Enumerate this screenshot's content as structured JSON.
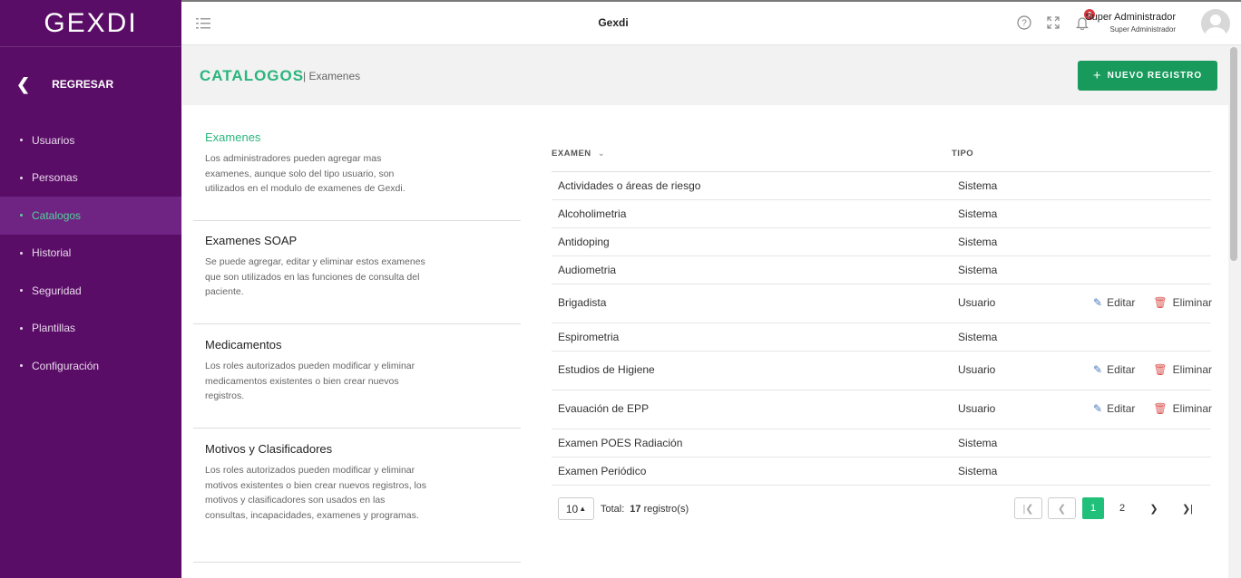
{
  "sidebar": {
    "logo": "GEXDI",
    "back_label": "REGRESAR",
    "items": [
      {
        "label": "Usuarios"
      },
      {
        "label": "Personas"
      },
      {
        "label": "Catalogos"
      },
      {
        "label": "Historial"
      },
      {
        "label": "Seguridad"
      },
      {
        "label": "Plantillas"
      },
      {
        "label": "Configuración"
      }
    ]
  },
  "header": {
    "title": "Gexdi",
    "notifications_count": "2",
    "user_name": "Super Administrador",
    "user_role": "Super Administrador"
  },
  "page": {
    "title": "CATALOGOS",
    "subtitle": "| Examenes",
    "new_button": "NUEVO REGISTRO"
  },
  "catalogs": [
    {
      "title": "Examenes",
      "desc": "Los administradores pueden agregar mas examenes, aunque solo del tipo usuario, son utilizados en el modulo de examenes de Gexdi."
    },
    {
      "title": "Examenes SOAP",
      "desc": "Se puede agregar, editar y eliminar estos examenes que son utilizados en las funciones de consulta del paciente."
    },
    {
      "title": "Medicamentos",
      "desc": "Los roles autorizados pueden modificar y eliminar medicamentos existentes o bien crear nuevos registros."
    },
    {
      "title": "Motivos y Clasificadores",
      "desc": "Los roles autorizados pueden modificar y eliminar motivos existentes o bien crear nuevos registros, los motivos y clasificadores son usados en las consultas, incapacidades, examenes y programas."
    }
  ],
  "table": {
    "col_examen": "EXAMEN",
    "col_tipo": "TIPO",
    "edit_label": "Editar",
    "delete_label": "Eliminar",
    "rows": [
      {
        "examen": "Actividades o áreas de riesgo",
        "tipo": "Sistema"
      },
      {
        "examen": "Alcoholimetria",
        "tipo": "Sistema"
      },
      {
        "examen": "Antidoping",
        "tipo": "Sistema"
      },
      {
        "examen": "Audiometria",
        "tipo": "Sistema"
      },
      {
        "examen": "Brigadista",
        "tipo": "Usuario"
      },
      {
        "examen": "Espirometria",
        "tipo": "Sistema"
      },
      {
        "examen": "Estudios de Higiene",
        "tipo": "Usuario"
      },
      {
        "examen": "Evauación de EPP",
        "tipo": "Usuario"
      },
      {
        "examen": "Examen POES Radiación",
        "tipo": "Sistema"
      },
      {
        "examen": "Examen Periódico",
        "tipo": "Sistema"
      }
    ]
  },
  "footer": {
    "page_size": "10",
    "total_label": "Total:",
    "total_value": "17",
    "total_suffix": "registro(s)",
    "current_page": "1",
    "next_page": "2"
  },
  "colors": {
    "sidebar": "#5a0d66",
    "accent": "#2ab57d",
    "button": "#189a5c"
  }
}
